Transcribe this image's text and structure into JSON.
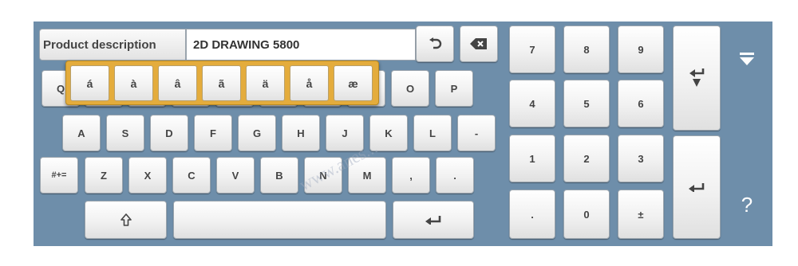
{
  "field": {
    "label": "Product description",
    "value": "2D DRAWING 5800"
  },
  "keyboard": {
    "row1": [
      "Q",
      "O",
      "P"
    ],
    "row2": [
      "A",
      "S",
      "D",
      "F",
      "G",
      "H",
      "J",
      "K",
      "L",
      "-"
    ],
    "row3": [
      "#+=",
      "Z",
      "X",
      "C",
      "V",
      "B",
      "N",
      "M",
      ",",
      "."
    ],
    "accent_popup": [
      "á",
      "à",
      "â",
      "ã",
      "ä",
      "å",
      "æ"
    ]
  },
  "numpad": {
    "keys": [
      "7",
      "8",
      "9",
      "4",
      "5",
      "6",
      "1",
      "2",
      "3",
      ".",
      "0",
      "±"
    ]
  },
  "side": {
    "help": "?"
  },
  "watermark": "www.anes...",
  "colors": {
    "panel_bg": "#6e8eaa",
    "key_face": "#f1f1f1",
    "popup_accent": "#e4ac3c",
    "text": "#444444"
  },
  "icons": {
    "undo": "undo-icon",
    "backspace": "backspace-icon",
    "shift": "shift-icon",
    "enter": "enter-icon",
    "enter_down": "enter-down-icon",
    "collapse": "collapse-keyboard-icon"
  }
}
